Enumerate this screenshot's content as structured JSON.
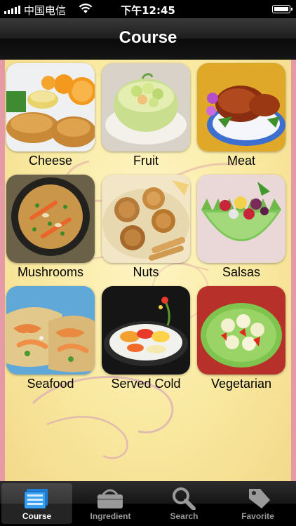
{
  "status_bar": {
    "carrier": "中国电信",
    "time": "下午12:45"
  },
  "nav": {
    "title": "Course"
  },
  "categories": [
    {
      "label": "Cheese"
    },
    {
      "label": "Fruit"
    },
    {
      "label": "Meat"
    },
    {
      "label": "Mushrooms"
    },
    {
      "label": "Nuts"
    },
    {
      "label": "Salsas"
    },
    {
      "label": "Seafood"
    },
    {
      "label": "Served Cold"
    },
    {
      "label": "Vegetarian"
    }
  ],
  "tabs": [
    {
      "label": "Course",
      "icon": "course-icon",
      "active": true
    },
    {
      "label": "Ingredient",
      "icon": "basket-icon",
      "active": false
    },
    {
      "label": "Search",
      "icon": "search-icon",
      "active": false
    },
    {
      "label": "Favorite",
      "icon": "tag-icon",
      "active": false
    }
  ],
  "colors": {
    "accent_border": "#e59aa6",
    "background": "#f9e9a0",
    "nav_bar": "#1c1c1c",
    "tab_active": "#ffffff",
    "tab_inactive": "#9a9a9a"
  }
}
